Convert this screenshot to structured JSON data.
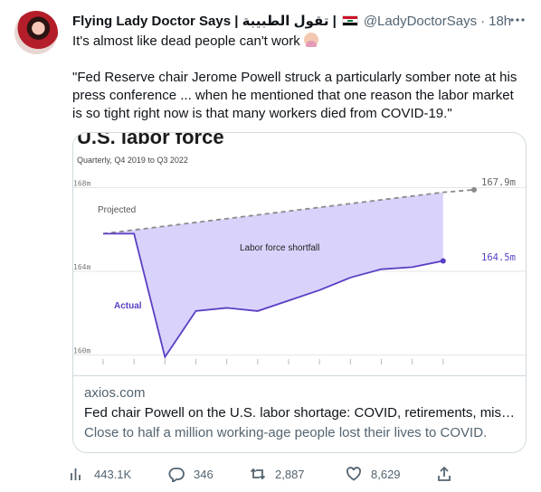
{
  "tweet": {
    "display_name": "Flying Lady Doctor Says | تقول الطبيبة |",
    "flag_icon": "iraq-flag-icon",
    "handle": "@LadyDoctorSays",
    "separator": "·",
    "time": "18h",
    "text_line1": "It's almost like dead people can't work",
    "text_emoji": "woman-facepalming-emoji",
    "quote": "\"Fed Reserve chair Jerome Powell struck a particularly somber note at his press conference ... when he mentioned that one reason the labor market is so tight right now is that many workers died from COVID-19.\""
  },
  "card": {
    "domain": "axios.com",
    "title": "Fed chair Powell on the U.S. labor shortage: COVID, retirements, missin...",
    "description": "Close to half a million working-age people lost their lives to COVID."
  },
  "chart_data": {
    "type": "line",
    "title": "U.S. labor force",
    "subtitle": "Quarterly, Q4 2019 to Q3 2022",
    "ylim": [
      159.5,
      168.5
    ],
    "y_ticks": [
      168,
      164,
      160
    ],
    "y_tick_labels": [
      "168m",
      "164m",
      "160m"
    ],
    "x_periods": 12,
    "series": [
      {
        "name": "Projected",
        "dashed": true,
        "values": [
          165.8,
          165.98,
          166.16,
          166.34,
          166.52,
          166.7,
          166.88,
          167.06,
          167.24,
          167.42,
          167.6,
          167.78,
          167.9
        ]
      },
      {
        "name": "Actual",
        "dashed": false,
        "values": [
          165.8,
          165.8,
          159.9,
          162.1,
          162.25,
          162.1,
          162.6,
          163.1,
          163.7,
          164.1,
          164.2,
          164.5
        ]
      }
    ],
    "annotations": {
      "shortfall": "Labor force shortfall",
      "projected_end": "167.9m",
      "actual_end": "164.5m"
    },
    "colors": {
      "projected": "#8a8a8a",
      "actual": "#5b3fc4",
      "fill": "#d9d2fb"
    }
  },
  "actions": {
    "views": "443.1K",
    "replies": "346",
    "retweets": "2,887",
    "likes": "8,629"
  }
}
